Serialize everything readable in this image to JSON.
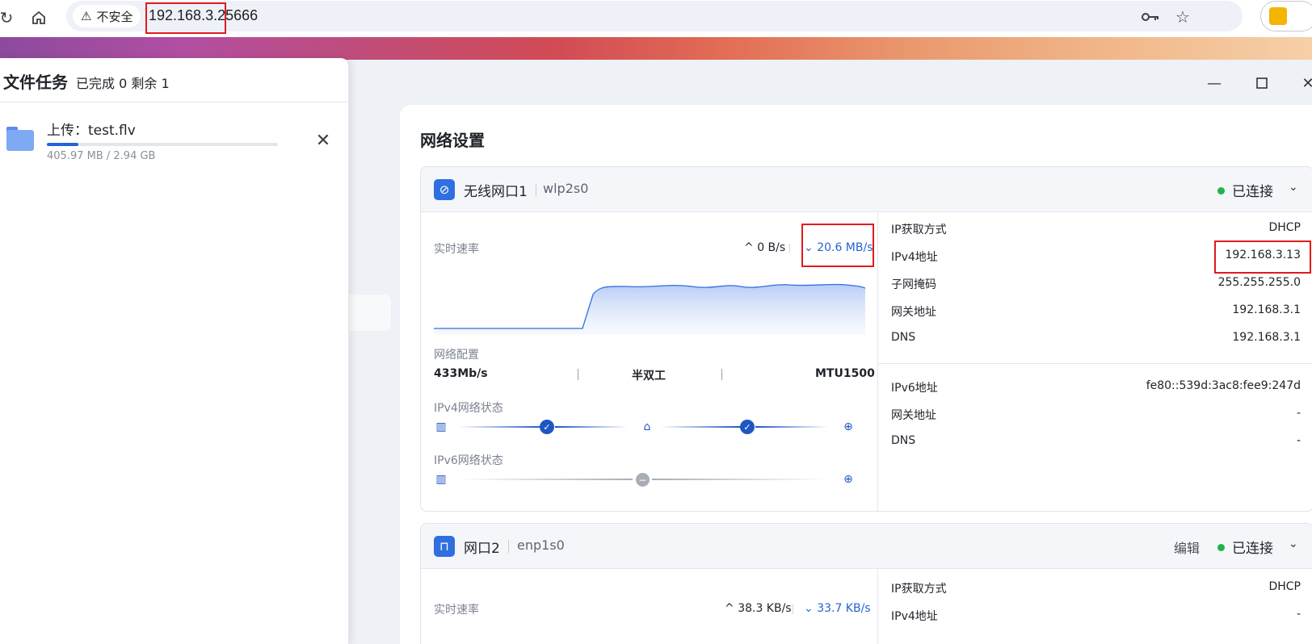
{
  "browser": {
    "security_label": "不安全",
    "url": "192.168.3.25666"
  },
  "tasks": {
    "title": "文件任务",
    "summary": "已完成 0 剩余 1",
    "items": [
      {
        "name": "上传：test.flv",
        "size": "405.97 MB / 2.94 GB",
        "progress": 0.135
      }
    ]
  },
  "page": {
    "title": "网络设置"
  },
  "interfaces": [
    {
      "name": "无线网口1",
      "device": "wlp2s0",
      "status": "已连接",
      "realtime_label": "实时速率",
      "upload": "0 B/s",
      "download": "20.6 MB/s",
      "config_label": "网络配置",
      "config": [
        "433Mb/s",
        "半双工",
        "MTU1500"
      ],
      "ipv4_status_label": "IPv4网络状态",
      "ipv6_status_label": "IPv6网络状态",
      "ipv4_info": [
        {
          "key": "IP获取方式",
          "value": "DHCP"
        },
        {
          "key": "IPv4地址",
          "value": "192.168.3.13"
        },
        {
          "key": "子网掩码",
          "value": "255.255.255.0"
        },
        {
          "key": "网关地址",
          "value": "192.168.3.1"
        },
        {
          "key": "DNS",
          "value": "192.168.3.1"
        }
      ],
      "ipv6_info": [
        {
          "key": "IPv6地址",
          "value": "fe80::539d:3ac8:fee9:247d"
        },
        {
          "key": "网关地址",
          "value": "-"
        },
        {
          "key": "DNS",
          "value": "-"
        }
      ]
    },
    {
      "name": "网口2",
      "device": "enp1s0",
      "status": "已连接",
      "edit_label": "编辑",
      "realtime_label": "实时速率",
      "upload": "38.3 KB/s",
      "download": "33.7 KB/s",
      "ipv4_info": [
        {
          "key": "IP获取方式",
          "value": "DHCP"
        },
        {
          "key": "IPv4地址",
          "value": "-"
        }
      ]
    }
  ],
  "colors": {
    "accent": "#2463d6",
    "status_ok": "#22b14c",
    "highlight": "#e01b1b"
  }
}
